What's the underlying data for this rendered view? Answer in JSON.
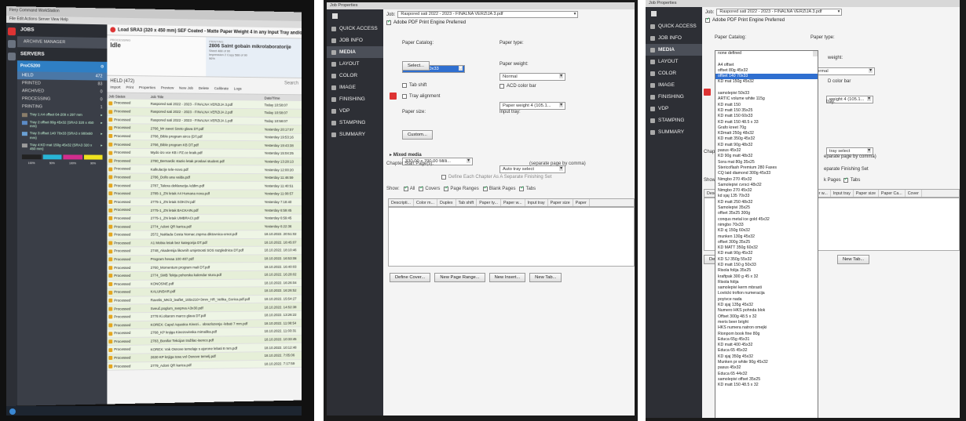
{
  "cw": {
    "window_title": "Fiery Command WorkStation",
    "menu": "File  Edit  Actions  Server  View  Help",
    "nav": {
      "jobs": "JOBS",
      "archive": "ARCHIVE MANAGER",
      "servers": "SERVERS"
    },
    "server_name": "ProC5200",
    "server_count": "⚙",
    "queues": [
      {
        "label": "HELD",
        "count": "472"
      },
      {
        "label": "PRINTED",
        "count": "83"
      },
      {
        "label": "ARCHIVED",
        "count": "0"
      },
      {
        "label": "PROCESSING",
        "count": "0"
      },
      {
        "label": "PRINTING",
        "count": "1"
      }
    ],
    "trays": [
      {
        "label": "Tray 1:A4 offset 64-209 x 297 mm",
        "color": "#8a7d6a"
      },
      {
        "label": "Tray 2:offset 80g 45x32 (SRA3 320 x 450 mm)",
        "color": "#5c8bc6"
      },
      {
        "label": "Tray 3:offset 140 70x33 (SRA3 x 900x60 mm)",
        "color": "#6aa0d4"
      },
      {
        "label": "Tray 4:KD mat 150g 45x32 (SRA3 320 x 450 mm)",
        "color": "#9c9c9c"
      }
    ],
    "toner": [
      {
        "pct": "100%",
        "color": "#222222"
      },
      {
        "pct": "50%",
        "color": "#28b5d6"
      },
      {
        "pct": "100%",
        "color": "#d22d8d"
      },
      {
        "pct": "90%",
        "color": "#efe21f"
      }
    ],
    "alert": "Load SRA3 (320 x 450 mm) SEF Coated - Matte Paper Weight 4 in any Input Tray and/or change paper",
    "processing_label": "PROCESSING",
    "processing_value": "Idle",
    "printing_label": "PRINTING",
    "printing_job": "2806 Saint gobain mikrolaboratorije",
    "printing_sheet": "Sheet 488 of 90",
    "printing_impr": "Impression 2  Copy 588 of 90",
    "printing_pct": "96%",
    "held_header": "HELD (472)",
    "search": "Search",
    "toolbar": [
      "Import",
      "Print",
      "Properties",
      "Preview",
      "New Job",
      "Delete",
      "Calibrate",
      "Logs"
    ],
    "columns": [
      "Job Status",
      "Job Title",
      "Date/Time"
    ],
    "jobs": [
      [
        "Processed",
        "Raspored sati 2022 - 2023 - FINALNA VERZIJA 3.pdf",
        "Today 10:58:07"
      ],
      [
        "Processed",
        "Raspored sati 2022 - 2023 - FINALNA VERZIJA 2.pdf",
        "Today 10:58:07"
      ],
      [
        "Processed",
        "Raspored sati 2022 - 2023 - FINALNA VERZIJA 1.pdf",
        "Today 10:58:07"
      ],
      [
        "Processed",
        "2766_Mr zavet Szeto glava DT.pdf",
        "Yesterday 20:17:07"
      ],
      [
        "Processed",
        "2766_Bible program sirco (DT.pdf",
        "Yesterday 19:53:16"
      ],
      [
        "Processed",
        "2766_Bible program KB DT.pdf",
        "Yesterday 19:43:38"
      ],
      [
        "Processed",
        "Mydo izo vce KB i PZ.ce kraik.pdf",
        "Yesterday 15:04:25"
      ],
      [
        "Processed",
        "2780_Bernardic stazio letak proslavi student.pdf",
        "Yesterday 13:28:13"
      ],
      [
        "Processed",
        "Kalkulacije tele-novo.pdf",
        "Yesterday 12:00:20"
      ],
      [
        "Processed",
        "2786_Dollo ana valda.pdf",
        "Yesterday 11:46:59"
      ],
      [
        "Processed",
        "2787_Talexa deklaracija Addim.pdf",
        "Yesterday 11:40:51"
      ],
      [
        "Processed",
        "2785-1_ZN letak A4 Humana nova.pdf",
        "Yesterday 11:08:57"
      ],
      [
        "Processed",
        "2775-1_ZN letak SOKOV.pdf",
        "Yesterday 7:18:40"
      ],
      [
        "Processed",
        "2775-1_ZN letak BACKAIN.pdf",
        "Yesterday 6:59:45"
      ],
      [
        "Processed",
        "2775-1_ZN letak UMBRACI.pdf",
        "Yesterday 6:59:45"
      ],
      [
        "Processed",
        "2774_Adoni QR karica.pdf",
        "Yesterday 6:22:36"
      ],
      [
        "Processed",
        "2572_Naklada Cesta Nomac.zsprna diktovnica-omot.pdf",
        "18.10.2022. 20:51:02"
      ],
      [
        "Processed",
        "A1 Mobia letak bez kategorija DT.pdf",
        "18.10.2022. 18:45:07"
      ],
      [
        "Processed",
        "2748_Akademija likovnih umjetnosti SOS razglednica DT.pdf",
        "18.10.2022. 18:10:46"
      ],
      [
        "Processed",
        "Program hevaa 100 487.pdf",
        "18.10.2022. 16:53:08"
      ],
      [
        "Processed",
        "2760_Momentum program mali DT.pdf",
        "18.10.2022. 16:40:03"
      ],
      [
        "Processed",
        "2774_SMB Tekija pohorska kalendar stura.pdf",
        "18.10.2022. 16:28:02"
      ],
      [
        "Processed",
        "KONOSNE.pdf",
        "18.10.2022. 16:26:04"
      ],
      [
        "Processed",
        "KALUNDAR.pdf",
        "18.10.2022. 16:26:52"
      ],
      [
        "Processed",
        "Ravelis_MK/2_leaflet_165x210+3mm_HR_Velika_Gorica.pdf.pdf",
        "18.10.2022. 15:54:27"
      ],
      [
        "Processed",
        "Sveuč.poglum_sveprva A3x30.pdf",
        "18.10.2022. 14:52:38"
      ],
      [
        "Processed",
        "2778 Ki.oltarom marco glava DT.pdf",
        "18.10.2022. 13:26:22"
      ],
      [
        "Processed",
        "KOREX: Capul Aquatica Kinezi... obrazlozenja -lebati 7 mm.pdf",
        "18.10.2022. 11:08:54"
      ],
      [
        "Processed",
        "2768_KP knjiga Kinezovinska mimalika.pdf",
        "18.10.2022. 11:03:31"
      ],
      [
        "Processed",
        "2783_Bonifar Tekcijan tražilac-isenco.pdf",
        "18.10.2022. 10:33:45"
      ],
      [
        "Processed",
        "KOREX: Vok Osnove temelaje s ajurone lebati 8 mm.pdf",
        "18.10.2022. 10:12:48"
      ],
      [
        "Processed",
        "2630 KP knjiga tose.vol Osnove temelj.pdf",
        "18.10.2022. 7:05:06"
      ],
      [
        "Processed",
        "2779_Adoni QR karica.pdf",
        "18.10.2022. 7:17:59"
      ]
    ]
  },
  "jp": {
    "title": "Job Properties",
    "nav": [
      "QUICK ACCESS",
      "JOB INFO",
      "MEDIA",
      "LAYOUT",
      "COLOR",
      "IMAGE",
      "FINISHING",
      "VDP",
      "STAMPING",
      "SUMMARY"
    ],
    "job_label": "Job:",
    "job_value": "Raspored sati 2022 - 2023 - FINALNA VERZIJA 3.pdf",
    "engine": "Adobe PDF Print Engine Preferred",
    "paper_catalog_label": "Paper Catalog:",
    "paper_catalog_value": "offset 140 70x33",
    "select_btn": "Select...",
    "paper_type_label": "Paper type:",
    "paper_type_value": "Normal",
    "paper_weight_label": "Paper weight:",
    "paper_weight_value": "Paper weight 4 (105.1...",
    "paper_weight_short": "weight 4 (105.1...",
    "tab_shift": "Tab shift",
    "acd_color_bar": "ACD color bar",
    "tray_alignment": "Tray alignment",
    "paper_size_label": "Paper size:",
    "paper_size_value": "330.00 x 700.00 Milli...",
    "custom_btn": "Custom...",
    "input_tray_label": "Input tray:",
    "input_tray_value": "Auto tray select",
    "input_tray_short": "tray select",
    "mixed_media": "Mixed media",
    "chapter_start": "Chapter Start Page(s):",
    "separate_hint": "(separate page by comma)",
    "define_each": "Define Each Chapter As A Separate Finishing Set",
    "show_label": "Show:",
    "show_opts": [
      "All",
      "Covers",
      "Page Ranges",
      "Blank Pages",
      "Tabs"
    ],
    "table_cols": [
      "Descripti...",
      "Color m...",
      "Duplex",
      "Tab shift",
      "Paper ty...",
      "Paper w...",
      "Input tray",
      "Paper size",
      "Paper"
    ],
    "table_cols_right": [
      "ty...",
      "Paper w...",
      "Input tray",
      "Paper size",
      "Paper Ca...",
      "Cover"
    ],
    "buttons": [
      "Define Cover...",
      "New Page Range...",
      "New Insert...",
      "New Tab..."
    ],
    "dropdown_items": [
      "none defined",
      "",
      "A4 offset",
      "offset 80g 45x32",
      "offset 140 70x33",
      "KD mat 150g 45x32",
      "",
      "samolepivi 50x33",
      "ARTIC volume white 115g",
      "KD matt 150",
      "KD matt 150 35x25",
      "KD matt 150 60x33",
      "KD matt 150 48.5 x 33",
      "Grafo kreet 70g",
      "KDmatt 250g 48x32",
      "KD matt 350g 45x32",
      "KD matt 90g 48x32",
      "pasus 45x32",
      "KD 90g matt 48x32",
      "Sora mat 80g 35x25",
      "Stericoflash Premium 280 Faxes",
      "CQ laid diamond 300g 45x33",
      "Nimgbo 270 45x32",
      "Samolepivi cvrsci 48x32",
      "Nimgbo 270 45x32",
      "kd sjaj 135 70x33",
      "KD matt 250 48x32",
      "Samolepivi 35x25",
      "offset 35x25 300g",
      "conqus metal ice gold 45x32",
      "nimgbo 70x33",
      "KD sj 150g 60x32",
      "munken 130g 45x32",
      "offset 300g 35x25",
      "KD MATT 350g 60x32",
      "KD matt 90g 45x32",
      "KD SJ 350g 55x32",
      "KD matt 150 g 50x33",
      "Risola folija 35x25",
      "kraftpak 300 g 45 x 32",
      "Risola folija",
      "samolepivi kerm mbrasti",
      "Loviicki trofion numeracija",
      "poyivce nada",
      "KD sjaj 135g 45x32",
      "Numero HKS pohnda blok",
      "Offset 300g 48.5 x 32",
      "meris beer bright",
      "HKS numera natron omejki",
      "Rionpom book fine 80g",
      "Educa 65g 45x31",
      "KD matt 400 45x32",
      "Educa 65 45x32",
      "KD sjaj 350g 45x32",
      "Munken pr white 90g 45x32",
      "pasus 45x32",
      "Educa 65 44x32",
      "samolepivi offset 35x25",
      "KD matt 150 48.5 x 32"
    ],
    "dropdown_selected_index": 4,
    "right_labels": {
      "weight": "weight:",
      "color_bar": "D color bar",
      "tray": "tray:",
      "separate": "eparate page by comma)",
      "finishing": "eparate Finishing Set",
      "pages": "k Pages",
      "tabs": "Tabs",
      "new_tab": "New Tab...",
      "chap": "Chapt",
      "show": "Show",
      "desc": "Desc",
      "def": "Defi"
    }
  },
  "colors": {
    "accent": "#2f6fd0",
    "fiery_red": "#d33333",
    "server_blue": "#2f7fc4",
    "row_green": "#e6efd8"
  }
}
